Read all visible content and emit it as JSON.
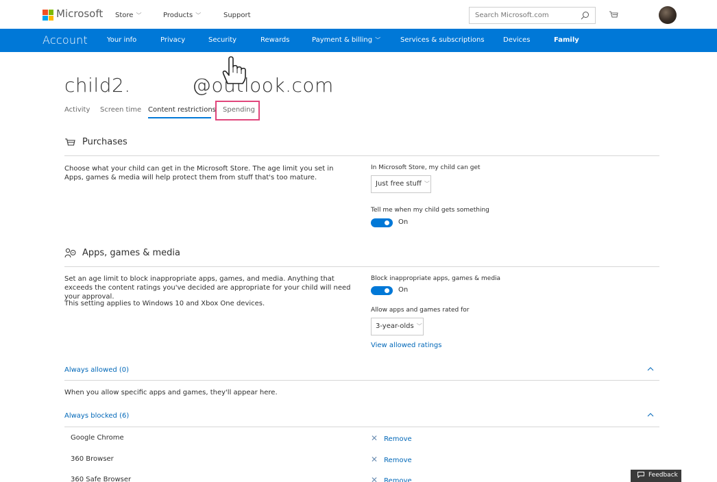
{
  "header": {
    "brand": "Microsoft",
    "logo_colors": [
      "#f25022",
      "#7fba00",
      "#00a4ef",
      "#ffb900"
    ],
    "nav": [
      {
        "label": "Store",
        "has_menu": true
      },
      {
        "label": "Products",
        "has_menu": true
      },
      {
        "label": "Support",
        "has_menu": false
      }
    ],
    "search_placeholder": "Search Microsoft.com",
    "search_icon": "search-icon",
    "cart_icon": "cart-icon"
  },
  "account_bar": {
    "title": "Account",
    "color": "#0078d7",
    "items": [
      {
        "label": "Your info"
      },
      {
        "label": "Privacy"
      },
      {
        "label": "Security"
      },
      {
        "label": "Rewards"
      },
      {
        "label": "Payment & billing",
        "has_menu": true
      },
      {
        "label": "Services & subscriptions"
      },
      {
        "label": "Devices"
      },
      {
        "label": "Family",
        "active": true
      }
    ]
  },
  "child": {
    "name": "child2.",
    "email": "@outlook.com",
    "tabs": [
      "Activity",
      "Screen time",
      "Content restrictions",
      "Spending"
    ],
    "active_tab": "Content restrictions",
    "highlighted_tab": "Spending",
    "highlight_color": "#e0457b"
  },
  "purchases": {
    "heading": "Purchases",
    "icon": "cart-icon",
    "description": "Choose what your child can get in the Microsoft Store. The age limit you set in Apps, games & media will help protect them from stuff that's too mature.",
    "store_label": "In Microsoft Store, my child can get",
    "store_value": "Just free stuff",
    "notify_label": "Tell me when my child gets something",
    "notify_state": "On"
  },
  "apps": {
    "heading": "Apps, games & media",
    "icon": "family-apps-icon",
    "description": "Set an age limit to block inappropriate apps, games, and media. Anything that exceeds the content ratings you've decided are appropriate for your child will need your approval.",
    "note": "This setting applies to Windows 10 and Xbox One devices.",
    "block_label": "Block inappropriate apps, games & media",
    "block_state": "On",
    "rated_label": "Allow apps and games rated for",
    "rated_value": "3-year-olds",
    "ratings_link": "View allowed ratings"
  },
  "always_allowed": {
    "heading": "Always allowed (0)",
    "empty_text": "When you allow specific apps and games, they'll appear here."
  },
  "always_blocked": {
    "heading": "Always blocked (6)",
    "remove_label": "Remove",
    "items": [
      "Google Chrome",
      "360 Browser",
      "360 Safe Browser"
    ]
  },
  "feedback": {
    "label": "Feedback",
    "icon": "comment-icon"
  }
}
